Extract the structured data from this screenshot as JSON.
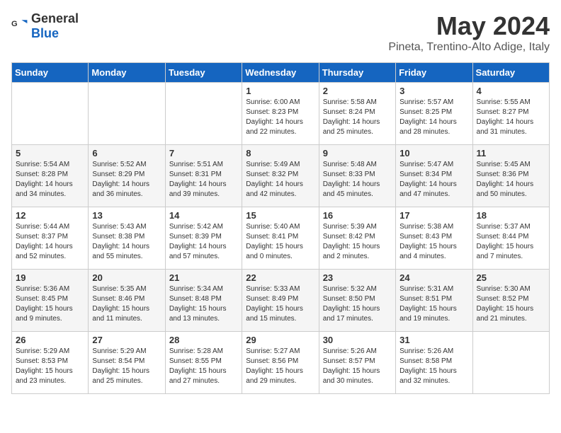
{
  "header": {
    "logo": {
      "general": "General",
      "blue": "Blue"
    },
    "title": "May 2024",
    "subtitle": "Pineta, Trentino-Alto Adige, Italy"
  },
  "days_of_week": [
    "Sunday",
    "Monday",
    "Tuesday",
    "Wednesday",
    "Thursday",
    "Friday",
    "Saturday"
  ],
  "weeks": [
    [
      {
        "day": "",
        "sunrise": "",
        "sunset": "",
        "daylight": ""
      },
      {
        "day": "",
        "sunrise": "",
        "sunset": "",
        "daylight": ""
      },
      {
        "day": "",
        "sunrise": "",
        "sunset": "",
        "daylight": ""
      },
      {
        "day": "1",
        "sunrise": "Sunrise: 6:00 AM",
        "sunset": "Sunset: 8:23 PM",
        "daylight": "Daylight: 14 hours and 22 minutes."
      },
      {
        "day": "2",
        "sunrise": "Sunrise: 5:58 AM",
        "sunset": "Sunset: 8:24 PM",
        "daylight": "Daylight: 14 hours and 25 minutes."
      },
      {
        "day": "3",
        "sunrise": "Sunrise: 5:57 AM",
        "sunset": "Sunset: 8:25 PM",
        "daylight": "Daylight: 14 hours and 28 minutes."
      },
      {
        "day": "4",
        "sunrise": "Sunrise: 5:55 AM",
        "sunset": "Sunset: 8:27 PM",
        "daylight": "Daylight: 14 hours and 31 minutes."
      }
    ],
    [
      {
        "day": "5",
        "sunrise": "Sunrise: 5:54 AM",
        "sunset": "Sunset: 8:28 PM",
        "daylight": "Daylight: 14 hours and 34 minutes."
      },
      {
        "day": "6",
        "sunrise": "Sunrise: 5:52 AM",
        "sunset": "Sunset: 8:29 PM",
        "daylight": "Daylight: 14 hours and 36 minutes."
      },
      {
        "day": "7",
        "sunrise": "Sunrise: 5:51 AM",
        "sunset": "Sunset: 8:31 PM",
        "daylight": "Daylight: 14 hours and 39 minutes."
      },
      {
        "day": "8",
        "sunrise": "Sunrise: 5:49 AM",
        "sunset": "Sunset: 8:32 PM",
        "daylight": "Daylight: 14 hours and 42 minutes."
      },
      {
        "day": "9",
        "sunrise": "Sunrise: 5:48 AM",
        "sunset": "Sunset: 8:33 PM",
        "daylight": "Daylight: 14 hours and 45 minutes."
      },
      {
        "day": "10",
        "sunrise": "Sunrise: 5:47 AM",
        "sunset": "Sunset: 8:34 PM",
        "daylight": "Daylight: 14 hours and 47 minutes."
      },
      {
        "day": "11",
        "sunrise": "Sunrise: 5:45 AM",
        "sunset": "Sunset: 8:36 PM",
        "daylight": "Daylight: 14 hours and 50 minutes."
      }
    ],
    [
      {
        "day": "12",
        "sunrise": "Sunrise: 5:44 AM",
        "sunset": "Sunset: 8:37 PM",
        "daylight": "Daylight: 14 hours and 52 minutes."
      },
      {
        "day": "13",
        "sunrise": "Sunrise: 5:43 AM",
        "sunset": "Sunset: 8:38 PM",
        "daylight": "Daylight: 14 hours and 55 minutes."
      },
      {
        "day": "14",
        "sunrise": "Sunrise: 5:42 AM",
        "sunset": "Sunset: 8:39 PM",
        "daylight": "Daylight: 14 hours and 57 minutes."
      },
      {
        "day": "15",
        "sunrise": "Sunrise: 5:40 AM",
        "sunset": "Sunset: 8:41 PM",
        "daylight": "Daylight: 15 hours and 0 minutes."
      },
      {
        "day": "16",
        "sunrise": "Sunrise: 5:39 AM",
        "sunset": "Sunset: 8:42 PM",
        "daylight": "Daylight: 15 hours and 2 minutes."
      },
      {
        "day": "17",
        "sunrise": "Sunrise: 5:38 AM",
        "sunset": "Sunset: 8:43 PM",
        "daylight": "Daylight: 15 hours and 4 minutes."
      },
      {
        "day": "18",
        "sunrise": "Sunrise: 5:37 AM",
        "sunset": "Sunset: 8:44 PM",
        "daylight": "Daylight: 15 hours and 7 minutes."
      }
    ],
    [
      {
        "day": "19",
        "sunrise": "Sunrise: 5:36 AM",
        "sunset": "Sunset: 8:45 PM",
        "daylight": "Daylight: 15 hours and 9 minutes."
      },
      {
        "day": "20",
        "sunrise": "Sunrise: 5:35 AM",
        "sunset": "Sunset: 8:46 PM",
        "daylight": "Daylight: 15 hours and 11 minutes."
      },
      {
        "day": "21",
        "sunrise": "Sunrise: 5:34 AM",
        "sunset": "Sunset: 8:48 PM",
        "daylight": "Daylight: 15 hours and 13 minutes."
      },
      {
        "day": "22",
        "sunrise": "Sunrise: 5:33 AM",
        "sunset": "Sunset: 8:49 PM",
        "daylight": "Daylight: 15 hours and 15 minutes."
      },
      {
        "day": "23",
        "sunrise": "Sunrise: 5:32 AM",
        "sunset": "Sunset: 8:50 PM",
        "daylight": "Daylight: 15 hours and 17 minutes."
      },
      {
        "day": "24",
        "sunrise": "Sunrise: 5:31 AM",
        "sunset": "Sunset: 8:51 PM",
        "daylight": "Daylight: 15 hours and 19 minutes."
      },
      {
        "day": "25",
        "sunrise": "Sunrise: 5:30 AM",
        "sunset": "Sunset: 8:52 PM",
        "daylight": "Daylight: 15 hours and 21 minutes."
      }
    ],
    [
      {
        "day": "26",
        "sunrise": "Sunrise: 5:29 AM",
        "sunset": "Sunset: 8:53 PM",
        "daylight": "Daylight: 15 hours and 23 minutes."
      },
      {
        "day": "27",
        "sunrise": "Sunrise: 5:29 AM",
        "sunset": "Sunset: 8:54 PM",
        "daylight": "Daylight: 15 hours and 25 minutes."
      },
      {
        "day": "28",
        "sunrise": "Sunrise: 5:28 AM",
        "sunset": "Sunset: 8:55 PM",
        "daylight": "Daylight: 15 hours and 27 minutes."
      },
      {
        "day": "29",
        "sunrise": "Sunrise: 5:27 AM",
        "sunset": "Sunset: 8:56 PM",
        "daylight": "Daylight: 15 hours and 29 minutes."
      },
      {
        "day": "30",
        "sunrise": "Sunrise: 5:26 AM",
        "sunset": "Sunset: 8:57 PM",
        "daylight": "Daylight: 15 hours and 30 minutes."
      },
      {
        "day": "31",
        "sunrise": "Sunrise: 5:26 AM",
        "sunset": "Sunset: 8:58 PM",
        "daylight": "Daylight: 15 hours and 32 minutes."
      },
      {
        "day": "",
        "sunrise": "",
        "sunset": "",
        "daylight": ""
      }
    ]
  ]
}
